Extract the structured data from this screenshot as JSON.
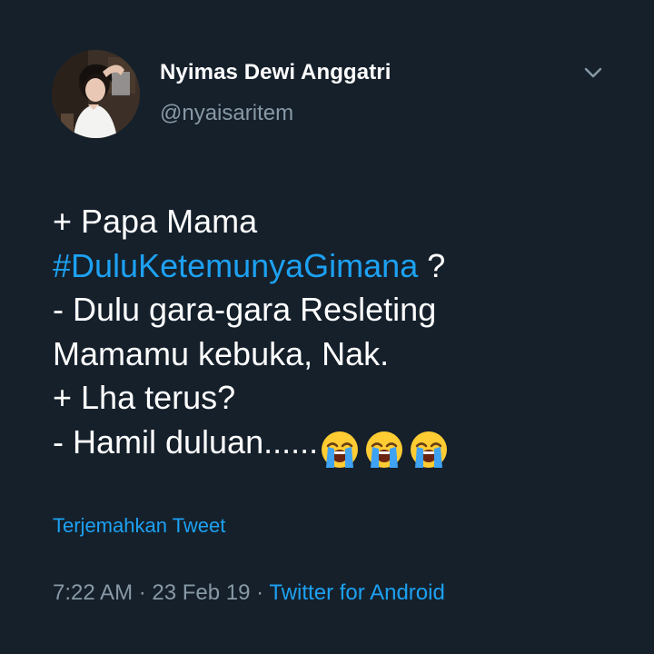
{
  "user": {
    "display_name": "Nyimas Dewi Anggatri",
    "handle": "@nyaisaritem"
  },
  "tweet": {
    "line_1": "+ Papa Mama",
    "hashtag": "#DuluKetemunyaGimana",
    "hashtag_suffix": " ?",
    "line_3": "- Dulu gara-gara Resleting",
    "line_4": "Mamamu kebuka, Nak.",
    "line_5": "+ Lha terus?",
    "line_6": "- Hamil duluan......",
    "emojis": [
      "loudly-crying-face",
      "loudly-crying-face",
      "loudly-crying-face"
    ]
  },
  "translate_label": "Terjemahkan Tweet",
  "meta": {
    "time": "7:22 AM",
    "separator_1": " · ",
    "date": "23 Feb 19",
    "separator_2": " · ",
    "source": "Twitter for Android"
  },
  "colors": {
    "background": "#15202b",
    "primary_text": "#ffffff",
    "secondary_text": "#8899a6",
    "link": "#1da1f2"
  },
  "icons": {
    "more_menu": "chevron-down-icon"
  }
}
